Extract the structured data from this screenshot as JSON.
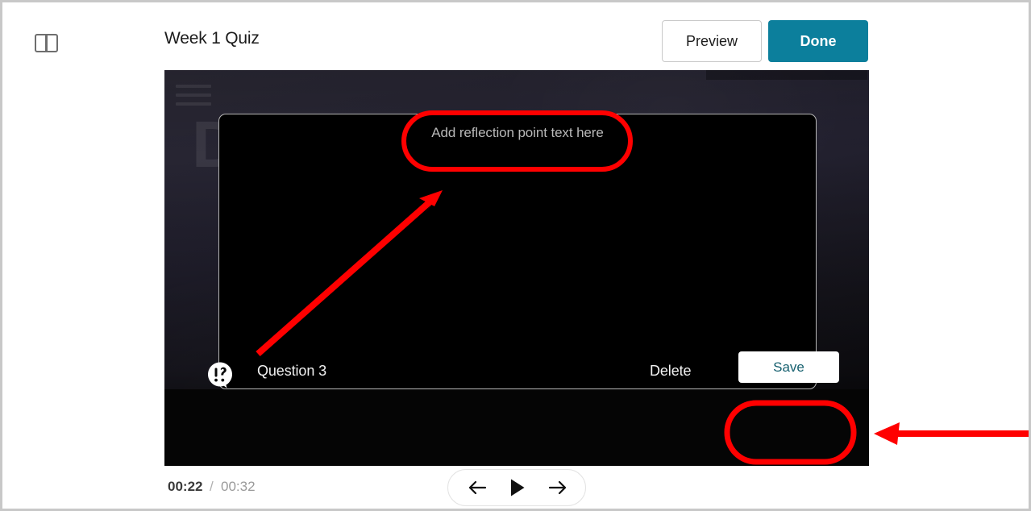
{
  "header": {
    "panel_toggle_icon": "panel-layout-icon",
    "title": "Week 1 Quiz",
    "preview_label": "Preview",
    "done_label": "Done"
  },
  "colors": {
    "done_button_bg": "#0c7f9c",
    "save_button_text": "#16606f",
    "annotation_red": "#ff0000",
    "stage_bg": "#232130",
    "page_border": "#c8c8c8"
  },
  "stage": {
    "background_letter": "D",
    "hamburger_icon": "hamburger-menu-icon",
    "reflection": {
      "placeholder": "Add reflection point text here",
      "value": ""
    },
    "footer": {
      "question_icon": "question-exclamation-bubble-icon",
      "question_label": "Question 3",
      "delete_label": "Delete",
      "save_label": "Save"
    }
  },
  "transport": {
    "current_time": "00:22",
    "separator": "/",
    "total_time": "00:32",
    "prev_icon": "arrow-left-icon",
    "play_icon": "play-icon",
    "next_icon": "arrow-right-icon"
  },
  "annotations": {
    "ellipse_placeholder": "red-ellipse-around-reflection-placeholder",
    "arrow_to_placeholder": "red-diagonal-arrow",
    "ellipse_save": "red-ellipse-around-save-button",
    "arrow_to_save": "red-horizontal-arrow"
  }
}
